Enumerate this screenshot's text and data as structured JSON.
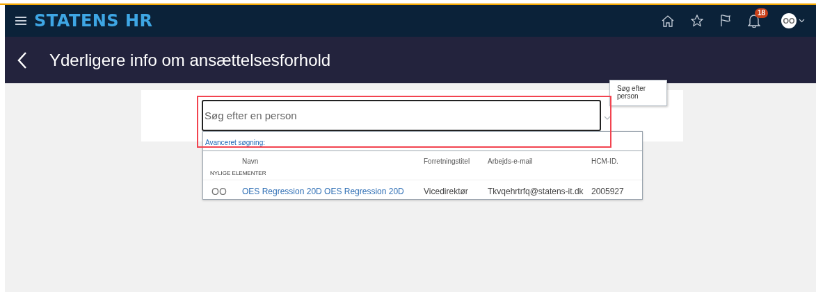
{
  "app": {
    "title": "STATENS HR",
    "notification_count": "18",
    "avatar_initials": "OO"
  },
  "page": {
    "title": "Yderligere info om ansættelsesforhold"
  },
  "search": {
    "placeholder": "Søg efter en person",
    "tooltip": "Søg efter person"
  },
  "dropdown": {
    "advanced_link": "Avanceret søgning:",
    "columns": [
      "Navn",
      "Forretningstitel",
      "Arbejds-e-mail",
      "HCM-ID."
    ],
    "section_label": "NYLIGE ELEMENTER",
    "rows": [
      {
        "initials": "OO",
        "name": "OES Regression 20D OES Regression 20D",
        "title": "Vicedirektør",
        "email": "Tkvqehrtrfq@statens-it.dk",
        "id": "2005927"
      }
    ]
  }
}
